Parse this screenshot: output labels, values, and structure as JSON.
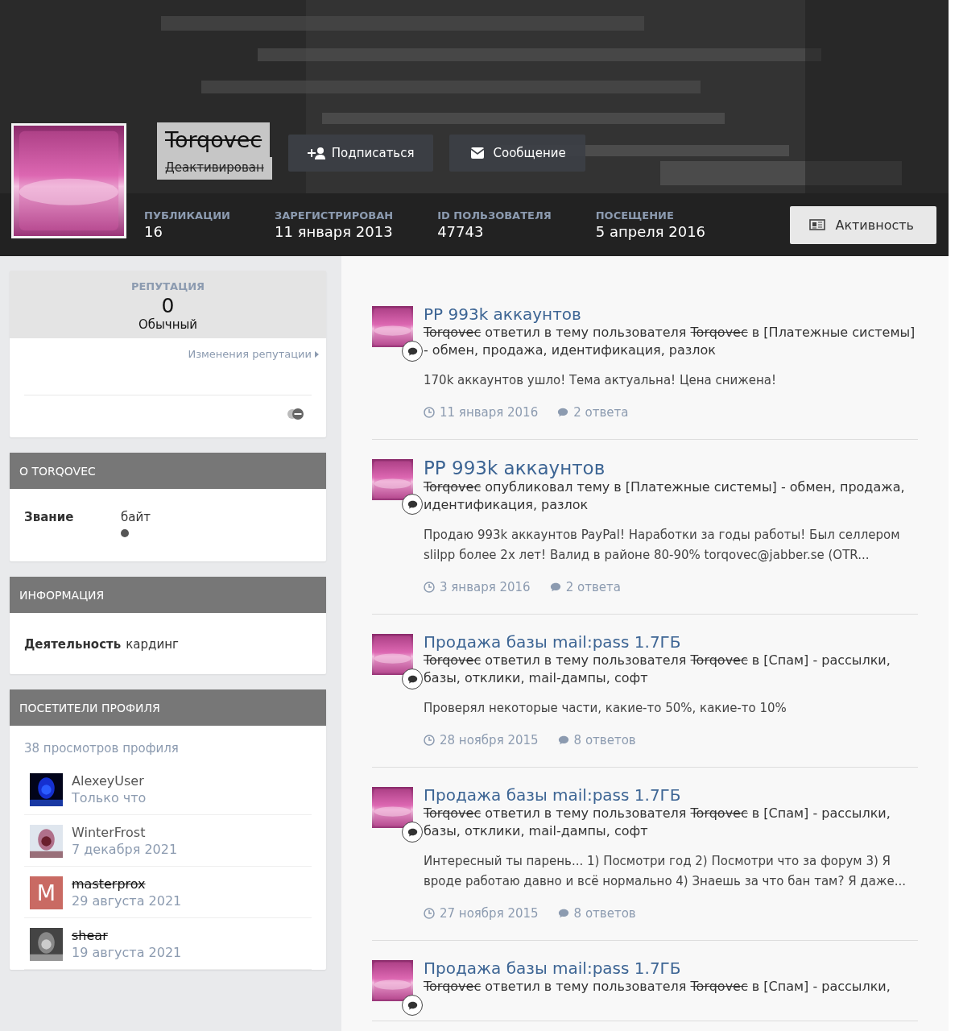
{
  "profile": {
    "name": "Torqovec",
    "name_struck": true,
    "status": "Деактивирован",
    "status_struck": true,
    "buttons": [
      {
        "kind": "follow",
        "label": "Подписаться"
      },
      {
        "kind": "message",
        "label": "Сообщение"
      }
    ],
    "stats": [
      {
        "label": "ПУБЛИКАЦИИ",
        "value": "16"
      },
      {
        "label": "ЗАРЕГИСТРИРОВАН",
        "value": "11 января 2013"
      },
      {
        "label": "ID ПОЛЬЗОВАТЕЛЯ",
        "value": "47743"
      },
      {
        "label": "ПОСЕЩЕНИЕ",
        "value": "5 апреля 2016"
      }
    ],
    "activity_button": "Активность"
  },
  "reputation": {
    "title": "РЕПУТАЦИЯ",
    "value": "0",
    "level_name": "Обычный",
    "link": "Изменения репутации"
  },
  "about": {
    "title": "О TORQOVEC",
    "fields": [
      {
        "label": "Звание",
        "value": "байт"
      }
    ]
  },
  "info": {
    "title": "ИНФОРМАЦИЯ",
    "fields": [
      {
        "label": "Деятельность",
        "value": "кардинг"
      }
    ]
  },
  "visitors": {
    "title": "ПОСЕТИТЕЛИ ПРОФИЛЯ",
    "views": "38 просмотров профиля",
    "items": [
      {
        "name": "AlexeyUser",
        "struck": false,
        "time": "Только что"
      },
      {
        "name": "WinterFrost",
        "struck": false,
        "time": "7 декабря 2021"
      },
      {
        "name": "masterprox",
        "struck": true,
        "time": "29 августа 2021",
        "avatar": {
          "kind": "letter",
          "letter": "M"
        }
      },
      {
        "name": "shear",
        "struck": true,
        "time": "19 августа 2021"
      }
    ]
  },
  "activity": [
    {
      "kind": "reply",
      "title": "PP 993k аккаунтов",
      "parts": [
        {
          "text": "Torqovec",
          "struck": true
        },
        {
          "text": " ответил в тему пользователя ",
          "struck": false
        },
        {
          "text": "Torqovec",
          "struck": true
        },
        {
          "text": " в [Платежные системы] - обмен, продажа, идентификация, разлок",
          "struck": false
        }
      ],
      "excerpt": "170k аккаунтов ушло! Тема актуальна! Цена снижена!",
      "date": "11 января 2016",
      "replies": "2 ответа"
    },
    {
      "kind": "topic",
      "title": "PP 993k аккаунтов",
      "parts": [
        {
          "text": "Torqovec",
          "struck": true
        },
        {
          "text": " опубликовал тему в [Платежные системы] - обмен, продажа, идентификация, разлок",
          "struck": false
        }
      ],
      "excerpt": "Продаю 993k аккаунтов PayPal! Наработки за годы работы! Был селлером slilpp более 2х лет! Валид в районе 80-90% torqovec@jabber.se (OTR...",
      "date": "3 января 2016",
      "replies": "2 ответа"
    },
    {
      "kind": "reply",
      "title": "Продажа базы mail:pass 1.7ГБ",
      "parts": [
        {
          "text": "Torqovec",
          "struck": true
        },
        {
          "text": " ответил в тему пользователя ",
          "struck": false
        },
        {
          "text": "Torqovec",
          "struck": true
        },
        {
          "text": " в [Спам] - рассылки, базы, отклики, mail-дампы, софт",
          "struck": false
        }
      ],
      "excerpt": "Проверял некоторые части, какие-то 50%, какие-то 10%",
      "date": "28 ноября 2015",
      "replies": "8 ответов"
    },
    {
      "kind": "reply",
      "title": "Продажа базы mail:pass 1.7ГБ",
      "parts": [
        {
          "text": "Torqovec",
          "struck": true
        },
        {
          "text": " ответил в тему пользователя ",
          "struck": false
        },
        {
          "text": "Torqovec",
          "struck": true
        },
        {
          "text": " в [Спам] - рассылки, базы, отклики, mail-дампы, софт",
          "struck": false
        }
      ],
      "excerpt": "Интересный ты парень... 1) Посмотри год 2) Посмотри что за форум 3) Я вроде работаю давно и всё нормально 4) Знаешь за что бан там? Я даже...",
      "date": "27 ноября 2015",
      "replies": "8 ответов"
    },
    {
      "kind": "reply",
      "title": "Продажа базы mail:pass 1.7ГБ",
      "parts": [
        {
          "text": "Torqovec",
          "struck": true
        },
        {
          "text": " ответил в тему пользователя ",
          "struck": false
        },
        {
          "text": "Torqovec",
          "struck": true
        },
        {
          "text": " в [Спам] - рассылки,",
          "struck": false
        }
      ]
    }
  ]
}
